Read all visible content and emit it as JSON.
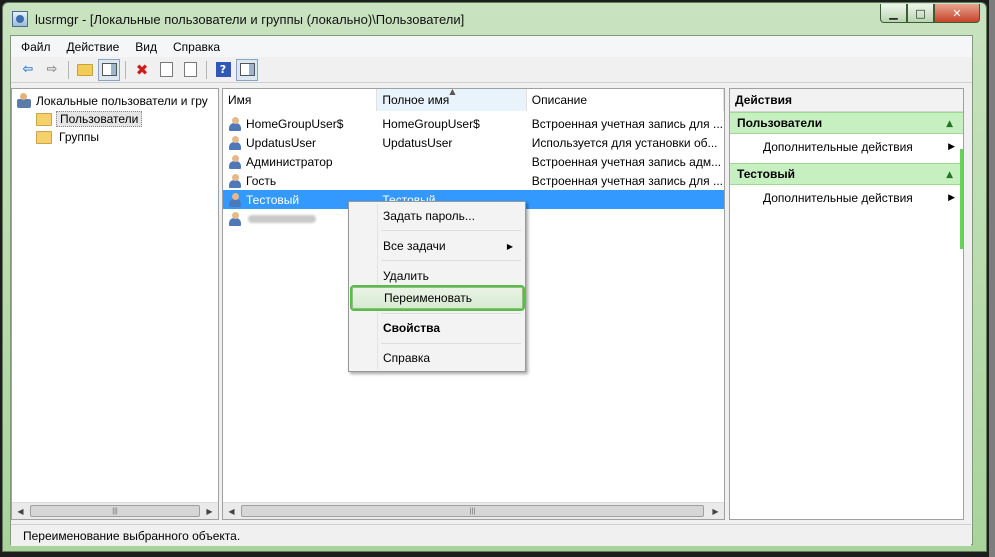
{
  "window": {
    "title": "lusrmgr - [Локальные пользователи и группы (локально)\\Пользователи]",
    "controls": {
      "minimize": "▁",
      "maximize": "□",
      "close": "✕"
    }
  },
  "menu": [
    "Файл",
    "Действие",
    "Вид",
    "Справка"
  ],
  "toolbar": {
    "icons": [
      "back-arrow",
      "forward-arrow",
      "up-folder",
      "show-hide-console-tree",
      "delete",
      "properties",
      "export-list",
      "help",
      "show-hide-action-pane"
    ]
  },
  "tree": {
    "root": "Локальные пользователи и гру",
    "nodes": [
      {
        "label": "Пользователи",
        "selected": true
      },
      {
        "label": "Группы",
        "selected": false
      }
    ]
  },
  "list": {
    "columns": [
      "Имя",
      "Полное имя",
      "Описание"
    ],
    "rows": [
      {
        "name": "HomeGroupUser$",
        "full": "HomeGroupUser$",
        "desc": "Встроенная учетная запись для ..."
      },
      {
        "name": "UpdatusUser",
        "full": "UpdatusUser",
        "desc": "Используется для установки об..."
      },
      {
        "name": "Администратор",
        "full": "",
        "desc": "Встроенная учетная запись адм..."
      },
      {
        "name": "Гость",
        "full": "",
        "desc": "Встроенная учетная запись для ..."
      },
      {
        "name": "Тестовый",
        "full": "Тестовый",
        "desc": ""
      }
    ]
  },
  "context_menu": {
    "items": [
      "Задать пароль...",
      "Все задачи",
      "Удалить",
      "Переименовать",
      "Свойства",
      "Справка"
    ],
    "highlighted": "Переименовать"
  },
  "actions": {
    "title": "Действия",
    "groups": [
      {
        "label": "Пользователи",
        "item": "Дополнительные действия"
      },
      {
        "label": "Тестовый",
        "item": "Дополнительные действия"
      }
    ]
  },
  "status": "Переименование выбранного объекта.",
  "colors": {
    "frame": "#a9d39b",
    "selection": "#3399ff",
    "action_group": "#c7f0c0",
    "highlight_outline": "#58bd45"
  }
}
